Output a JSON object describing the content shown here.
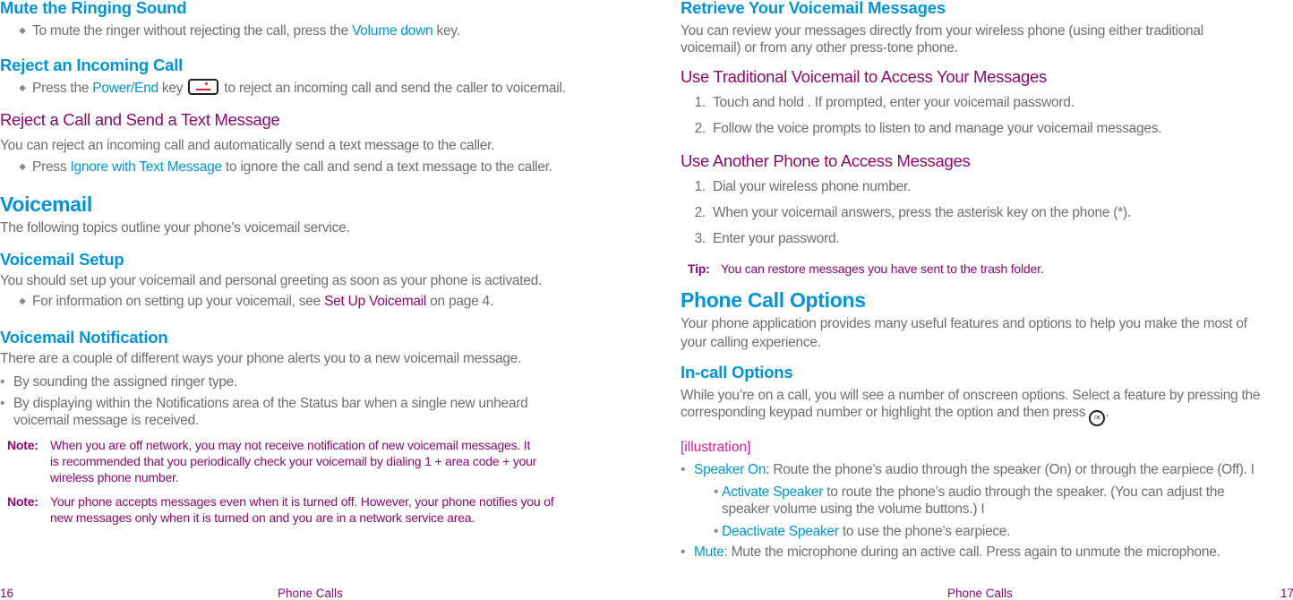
{
  "left_page": {
    "mute": {
      "heading": "Mute the Ringing Sound",
      "bullet_pre": "To mute the ringer without rejecting the call, press the ",
      "bullet_link": "Volume down",
      "bullet_post": " key."
    },
    "reject": {
      "heading": "Reject an Incoming Call",
      "bullet_pre": "Press the ",
      "bullet_link": "Power/End",
      "bullet_mid": " key ",
      "bullet_post": " to reject an incoming call and send the caller to voicemail."
    },
    "reject_text": {
      "heading": "Reject a Call and Send a Text Message",
      "intro": "You can reject an incoming call and automatically send a text message to the caller.",
      "bullet_pre": "Press ",
      "bullet_link": "Ignore with Text Message",
      "bullet_post": " to ignore the call and send a text message to the caller."
    },
    "voicemail": {
      "heading": "Voicemail",
      "intro": "The following topics outline your phone’s voicemail service."
    },
    "setup": {
      "heading": "Voicemail Setup",
      "intro": "You should set up your voicemail and personal greeting as soon as your phone is activated.",
      "bullet_pre": "For information on setting up your voicemail, see ",
      "bullet_link": "Set Up Voicemail",
      "bullet_post": " on page 4."
    },
    "notification": {
      "heading": "Voicemail Notification",
      "intro": "There are a couple of different ways your phone alerts you to a new voicemail message.",
      "bullets": [
        "By sounding the assigned ringer type.",
        "By displaying within the Notifications area of the Status bar when a single new unheard",
        "voicemail message is received."
      ]
    },
    "notes": [
      {
        "label": "Note:",
        "lines": [
          "When you are off network, you may not receive notification of new voicemail messages. It",
          "is recommended that you periodically check your voicemail by dialing 1 + area code + your",
          "wireless phone number."
        ]
      },
      {
        "label": "Note:",
        "lines": [
          "Your phone accepts messages even when it is turned off. However, your phone notifies you of",
          "new messages only when it is turned on and you are in a network service area."
        ]
      }
    ],
    "footer": {
      "page_number": "16",
      "section": "Phone Calls"
    }
  },
  "right_page": {
    "retrieve": {
      "heading": "Retrieve Your Voicemail Messages",
      "intro_lines": [
        "You can review your messages directly from your wireless phone (using either traditional",
        "voicemail) or from any other press-tone phone."
      ]
    },
    "traditional": {
      "heading": "Use Traditional Voicemail to Access Your Messages",
      "steps": [
        {
          "num": "1.",
          "text": "Touch and hold . If prompted, enter your voicemail password."
        },
        {
          "num": "2.",
          "text": "Follow the voice prompts to listen to and manage your voicemail messages."
        }
      ]
    },
    "another": {
      "heading": "Use Another Phone to Access Messages",
      "steps": [
        {
          "num": "1.",
          "text": "Dial your wireless phone number."
        },
        {
          "num": "2.",
          "text": "When your voicemail answers, press the asterisk key on the phone (*)."
        },
        {
          "num": "3.",
          "text": "Enter your password."
        }
      ]
    },
    "tip": {
      "label": "Tip:",
      "text": "You can restore messages you have sent to the trash folder."
    },
    "options": {
      "heading": "Phone Call Options",
      "intro_lines": [
        "Your phone application provides many useful features and options to help you make the most of",
        "your calling experience."
      ]
    },
    "incall": {
      "heading": "In-call Options",
      "intro_line1": "While you’re on a call, you will see a number of onscreen options. Select a feature by pressing the",
      "intro_line2_pre": "corresponding keypad number or highlight the option and then press ",
      "intro_line2_post": ".",
      "ok_icon_label": "OK",
      "illustration": "[illustration]",
      "speaker": {
        "link": "Speaker On",
        "text": ": Route the phone’s audio through the speaker (On) or through the earpiece (Off). I",
        "sub": [
          {
            "link": "Activate Speaker",
            "text": " to route the phone’s audio through the speaker. (You can adjust the",
            "cont": "speaker volume using the volume buttons.) I"
          },
          {
            "link": "Deactivate Speaker",
            "text": " to use the phone’s earpiece."
          }
        ]
      },
      "mute": {
        "link": "Mute",
        "text": ": Mute the microphone during an active call. Press again to unmute the microphone."
      }
    },
    "footer": {
      "section": "Phone Calls",
      "page_number": "17"
    }
  }
}
